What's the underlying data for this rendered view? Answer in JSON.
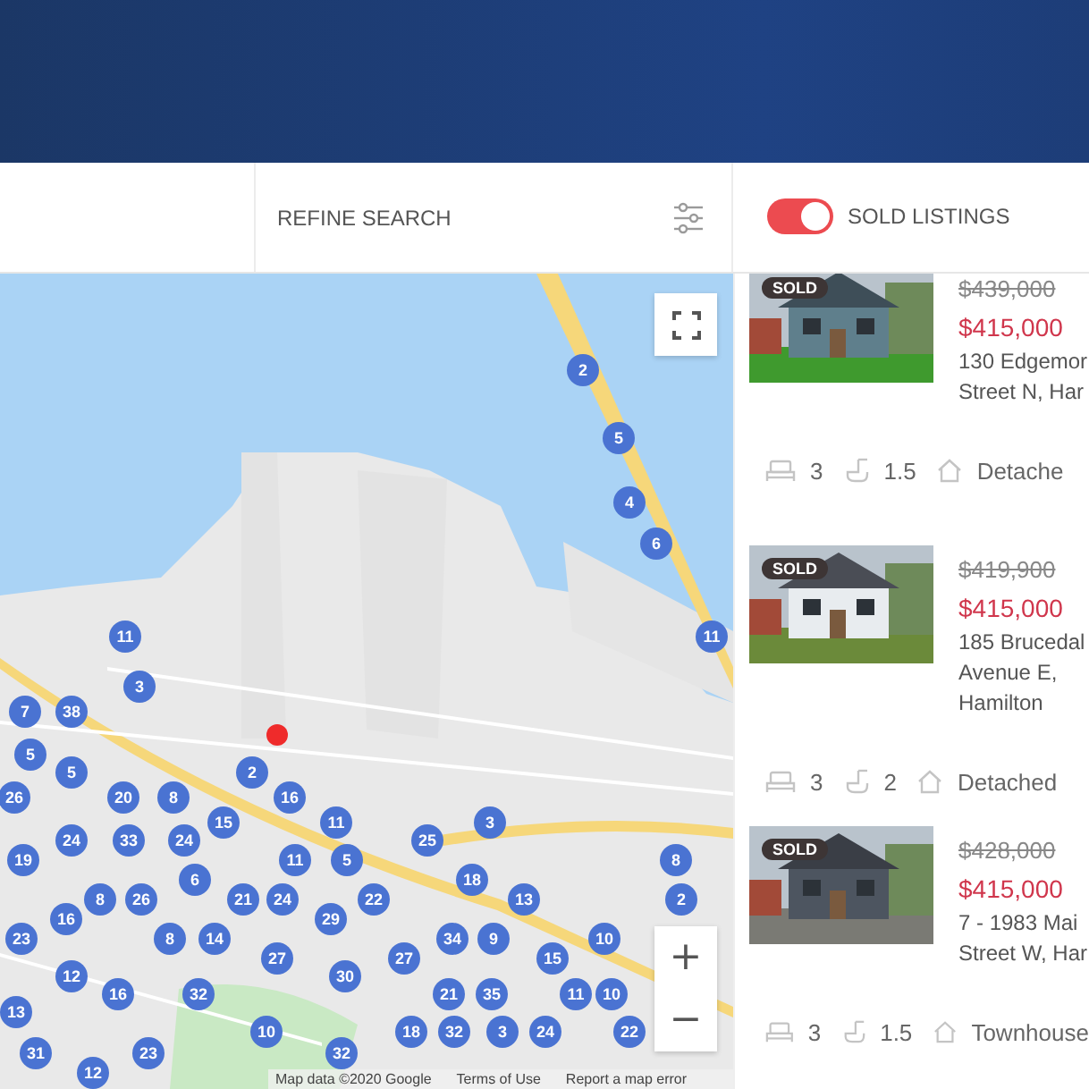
{
  "toolbar": {
    "refine_label": "REFINE SEARCH",
    "sold_toggle": {
      "label": "SOLD LISTINGS",
      "on": true
    }
  },
  "map": {
    "markers": [
      {
        "label": "2"
      },
      {
        "label": "5"
      },
      {
        "label": "4"
      },
      {
        "label": "6"
      },
      {
        "label": "11"
      },
      {
        "label": "11"
      },
      {
        "label": "3"
      },
      {
        "label": "7"
      },
      {
        "label": "38"
      },
      {
        "label": "5"
      },
      {
        "label": "5"
      },
      {
        "label": "2"
      },
      {
        "label": "26"
      },
      {
        "label": "20"
      },
      {
        "label": "8"
      },
      {
        "label": "16"
      },
      {
        "label": "15"
      },
      {
        "label": "11"
      },
      {
        "label": "3"
      },
      {
        "label": "24"
      },
      {
        "label": "33"
      },
      {
        "label": "24"
      },
      {
        "label": "25"
      },
      {
        "label": "19"
      },
      {
        "label": "11"
      },
      {
        "label": "5"
      },
      {
        "label": "8"
      },
      {
        "label": "6"
      },
      {
        "label": "18"
      },
      {
        "label": "8"
      },
      {
        "label": "26"
      },
      {
        "label": "21"
      },
      {
        "label": "24"
      },
      {
        "label": "22"
      },
      {
        "label": "13"
      },
      {
        "label": "2"
      },
      {
        "label": "16"
      },
      {
        "label": "29"
      },
      {
        "label": "23"
      },
      {
        "label": "8"
      },
      {
        "label": "14"
      },
      {
        "label": "34"
      },
      {
        "label": "9"
      },
      {
        "label": "10"
      },
      {
        "label": "27"
      },
      {
        "label": "27"
      },
      {
        "label": "15"
      },
      {
        "label": "12"
      },
      {
        "label": "30"
      },
      {
        "label": "16"
      },
      {
        "label": "32"
      },
      {
        "label": "21"
      },
      {
        "label": "35"
      },
      {
        "label": "11"
      },
      {
        "label": "10"
      },
      {
        "label": "13"
      },
      {
        "label": "10"
      },
      {
        "label": "18"
      },
      {
        "label": "32"
      },
      {
        "label": "3"
      },
      {
        "label": "24"
      },
      {
        "label": "22"
      },
      {
        "label": "31"
      },
      {
        "label": "23"
      },
      {
        "label": "32"
      },
      {
        "label": "12"
      }
    ],
    "zoom_in": "+",
    "zoom_out": "−",
    "attribution": [
      "Map data ©2020 Google",
      "Terms of Use",
      "Report a map error"
    ]
  },
  "listings": [
    {
      "badge": "SOLD",
      "old_price": "$439,000",
      "price": "$415,000",
      "address_lines": [
        "130 Edgemor",
        "Street N, Har"
      ],
      "beds": "3",
      "baths": "1.5",
      "type": "Detache"
    },
    {
      "badge": "SOLD",
      "old_price": "$419,900",
      "price": "$415,000",
      "address_lines": [
        "185 Brucedal",
        "Avenue E,",
        "Hamilton"
      ],
      "beds": "3",
      "baths": "2",
      "type": "Detached"
    },
    {
      "badge": "SOLD",
      "old_price": "$428,000",
      "price": "$415,000",
      "address_lines": [
        "7 - 1983 Mai",
        "Street W, Har"
      ],
      "beds": "3",
      "baths": "1.5",
      "type": "Townhouse"
    }
  ]
}
